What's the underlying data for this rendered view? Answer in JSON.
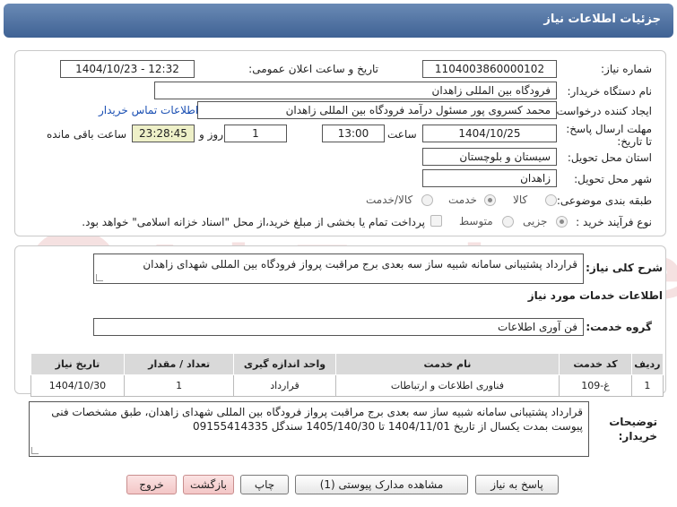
{
  "header": {
    "title": "جزئیات اطلاعات نیاز"
  },
  "watermark": {
    "text": "AriaTender.net"
  },
  "form": {
    "need_number_label": "شماره نیاز:",
    "need_number": "1104003860000102",
    "announce_label": "تاریخ و ساعت اعلان عمومی:",
    "announce_value": "1404/10/23 - 12:32",
    "buyer_label": "نام دستگاه خریدار:",
    "buyer_value": "فرودگاه بین المللی زاهدان",
    "creator_label": "ایجاد کننده درخواست:",
    "creator_value": "محمد کسروی پور مسئول درآمد فرودگاه بین المللی زاهدان",
    "contact_link": "اطلاعات تماس خریدار",
    "deadline_label": "مهلت ارسال پاسخ: تا تاریخ:",
    "deadline_date": "1404/10/25",
    "time_label": "ساعت",
    "deadline_time": "13:00",
    "days_value": "1",
    "days_label": "روز و",
    "remaining_time": "23:28:45",
    "remaining_label": "ساعت باقی مانده",
    "province_label": "استان محل تحویل:",
    "province_value": "سیستان و بلوچستان",
    "city_label": "شهر محل تحویل:",
    "city_value": "زاهدان",
    "category_label": "طبقه بندی موضوعی:",
    "category_options": [
      "کالا",
      "خدمت",
      "کالا/خدمت"
    ],
    "process_label": "نوع فرآیند خرید :",
    "process_options": [
      "جزیی",
      "متوسط"
    ],
    "payment_note": "پرداخت تمام یا بخشی از مبلغ خرید،از محل \"اسناد خزانه اسلامی\" خواهد بود."
  },
  "summary": {
    "label": "شرح کلی نیاز:",
    "value": "قرارداد پشتیبانی سامانه شبیه ساز سه بعدی برج مراقبت پرواز فرودگاه بین المللی شهدای زاهدان"
  },
  "services": {
    "section_title": "اطلاعات خدمات مورد نیاز",
    "group_label": "گروه خدمت:",
    "group_value": "فن آوری اطلاعات",
    "columns": [
      "ردیف",
      "کد خدمت",
      "نام خدمت",
      "واحد اندازه گیری",
      "تعداد / مقدار",
      "تاریخ نیاز"
    ],
    "rows": [
      [
        "1",
        "غ-109",
        "فناوری اطلاعات و ارتباطات",
        "قرارداد",
        "1",
        "1404/10/30"
      ]
    ]
  },
  "notes": {
    "label": "توضیحات خریدار:",
    "value": "قرارداد پشتیبانی سامانه شبیه ساز سه بعدی برج مراقبت پرواز فرودگاه بین المللی شهدای زاهدان، طبق مشخصات فنی پیوست بمدت یکسال از تاریخ 1404/11/01 تا 1405/140/30 سندگل 09155414335"
  },
  "buttons": {
    "reply": "پاسخ به نیاز",
    "attachments": "مشاهده مدارک پیوستی (1)",
    "print": "چاپ",
    "back": "بازگشت",
    "exit": "خروج"
  }
}
